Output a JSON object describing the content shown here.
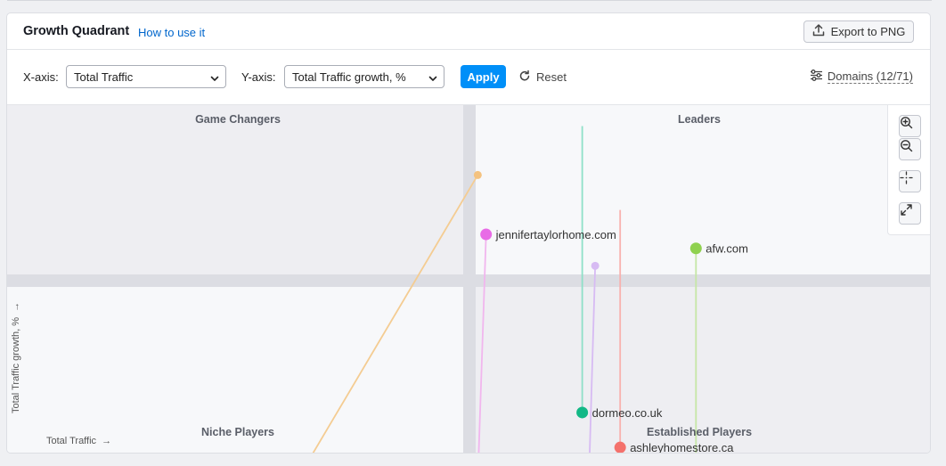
{
  "header": {
    "title": "Growth Quadrant",
    "how_to_link": "How to use it",
    "export_label": "Export to PNG"
  },
  "controls": {
    "x_axis_label": "X-axis:",
    "x_axis_value": "Total Traffic",
    "y_axis_label": "Y-axis:",
    "y_axis_value": "Total Traffic growth, %",
    "apply_label": "Apply",
    "reset_label": "Reset",
    "domains_label": "Domains (12/71)"
  },
  "chart": {
    "quadrants": {
      "top_left": "Game Changers",
      "top_right": "Leaders",
      "bottom_left": "Niche Players",
      "bottom_right": "Established Players"
    },
    "x_axis_title": "Total Traffic",
    "y_axis_title": "Total Traffic growth, %",
    "colors": {
      "quadrant_shaded": "#eeeef2",
      "quadrant_light": "#f7f8fa",
      "divider": "#dcdde3"
    }
  },
  "chart_data": {
    "type": "scatter",
    "axes": [
      "Total Traffic",
      "Total Traffic growth, %"
    ],
    "quadrant_divider": {
      "x": 0.5,
      "y": 0.5
    },
    "series": [
      {
        "name": "jenniferTaylorhome.com",
        "label": "jennifertaylorhome.com",
        "color": "#e86be6",
        "tail_color": "#f1b6ee",
        "point": [
          0.518,
          0.63
        ],
        "tail": [
          0.51,
          0.0
        ]
      },
      {
        "name": "afw.com",
        "label": "afw.com",
        "color": "#8fd14f",
        "tail_color": "#c5e6a6",
        "point": [
          0.745,
          0.59
        ],
        "tail": [
          0.745,
          0.0
        ]
      },
      {
        "name": "dormeo.co.uk",
        "label": "dormeo.co.uk",
        "color": "#12b886",
        "tail_color": "#8fe0c8",
        "point": [
          0.622,
          0.12
        ],
        "tail": [
          0.622,
          0.94
        ]
      },
      {
        "name": "ashleyhomestore.ca",
        "label": "ashleyhomestore.ca",
        "color": "#f4716c",
        "tail_color": "#f8b1ae",
        "point": [
          0.663,
          0.02
        ],
        "tail": [
          0.663,
          0.7
        ]
      },
      {
        "name": "orange-domain",
        "label": "",
        "color": "#f4c27f",
        "tail_color": "#f4cc92",
        "point": [
          0.509,
          0.8
        ],
        "tail": [
          0.33,
          0.0
        ]
      },
      {
        "name": "purple-domain",
        "label": "",
        "color": "#d7bbf3",
        "tail_color": "#d7bbf3",
        "point": [
          0.636,
          0.54
        ],
        "tail": [
          0.63,
          0.0
        ]
      }
    ]
  }
}
